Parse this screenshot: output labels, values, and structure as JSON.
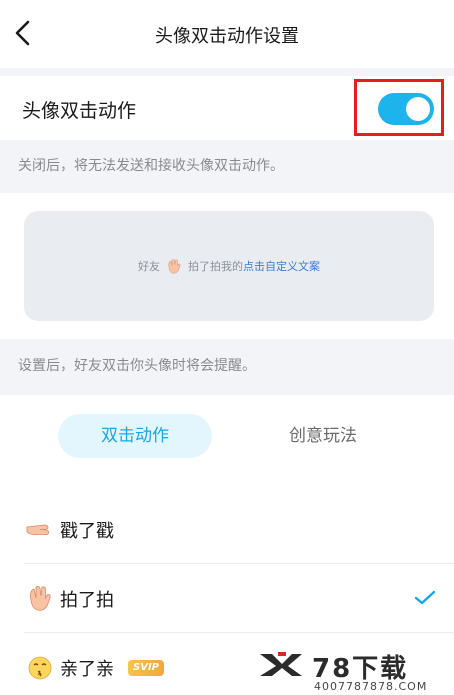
{
  "header": {
    "title": "头像双击动作设置"
  },
  "toggle": {
    "label": "头像双击动作",
    "enabled": true,
    "accent": "#1db4ee",
    "highlight_color": "#e61e1e"
  },
  "hints": {
    "after_off": "关闭后，将无法发送和接收头像双击动作。",
    "after_set": "设置后，好友双击你头像时将会提醒。"
  },
  "preview": {
    "prefix": "好友",
    "action": "拍了拍我的",
    "link": "点击自定义文案",
    "icon": "waving-hand-icon"
  },
  "tabs": [
    {
      "label": "双击动作",
      "active": true
    },
    {
      "label": "创意玩法",
      "active": false
    }
  ],
  "actions": [
    {
      "label": "戳了戳",
      "icon": "pointing-hand-icon",
      "selected": false
    },
    {
      "label": "拍了拍",
      "icon": "waving-hand-icon",
      "selected": true
    },
    {
      "label": "亲了亲",
      "icon": "kiss-face-icon",
      "badge": "SVIP",
      "selected": false
    }
  ],
  "watermark": {
    "brand": "78下载",
    "phone": "4007787878.COM"
  }
}
